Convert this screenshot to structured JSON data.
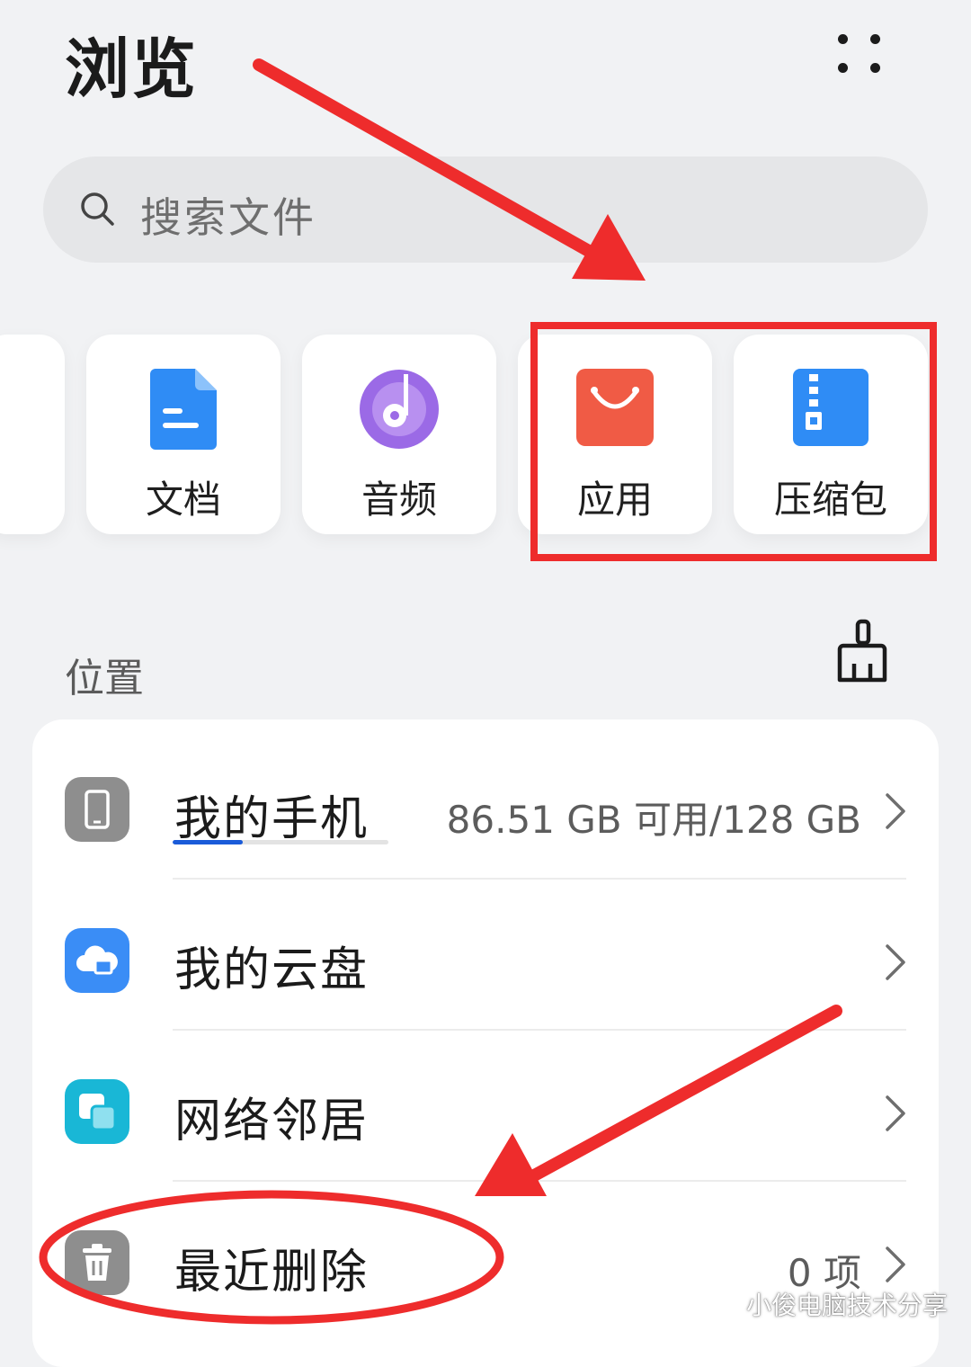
{
  "header": {
    "title": "浏览"
  },
  "search": {
    "placeholder": "搜索文件"
  },
  "categories": [
    {
      "label": "文档",
      "icon": "document-icon",
      "color": "#2f8cf5"
    },
    {
      "label": "音频",
      "icon": "music-disc-icon",
      "color": "#9b6ae6"
    },
    {
      "label": "应用",
      "icon": "shopping-bag-icon",
      "color": "#f05b45"
    },
    {
      "label": "压缩包",
      "icon": "zip-archive-icon",
      "color": "#2f8cf5"
    }
  ],
  "locations": {
    "section_title": "位置",
    "items": [
      {
        "label": "我的手机",
        "detail": "86.51 GB 可用/128 GB",
        "icon": "phone-icon",
        "color": "#8e8e8e",
        "storage_used_fraction": 0.324
      },
      {
        "label": "我的云盘",
        "detail": "",
        "icon": "cloud-icon",
        "color": "#3a8df6"
      },
      {
        "label": "网络邻居",
        "detail": "",
        "icon": "network-icon",
        "color": "#19b7d6"
      },
      {
        "label": "最近删除",
        "detail": "0 项",
        "icon": "trash-icon",
        "color": "#8e8e8e"
      }
    ]
  },
  "watermark": {
    "text": "小俊电脑技术分享"
  },
  "colors": {
    "annotation": "#ee2c2c",
    "accent": "#1a5bd9",
    "background": "#f1f2f4"
  }
}
